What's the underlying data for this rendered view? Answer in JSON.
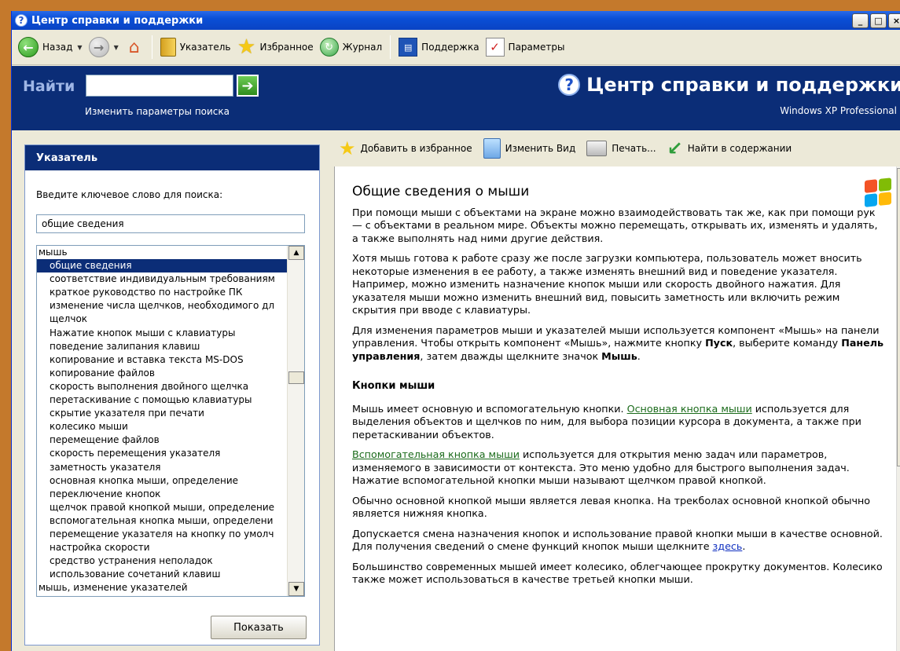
{
  "window": {
    "title": "Центр справки и поддержки",
    "controls": [
      "_",
      "□",
      "×"
    ]
  },
  "toolbar": {
    "back_label": "Назад",
    "index_label": "Указатель",
    "favorites_label": "Избранное",
    "history_label": "Журнал",
    "support_label": "Поддержка",
    "options_label": "Параметры"
  },
  "search": {
    "find_label": "Найти",
    "query": "",
    "go_symbol": "➔",
    "change_options_link": "Изменить параметры поиска"
  },
  "header": {
    "title": "Центр справки и поддержки",
    "edition": "Windows XP Professional"
  },
  "index_panel": {
    "title": "Указатель",
    "keyword_label": "Введите ключевое слово для поиска:",
    "keyword_value": "общие сведения",
    "items": [
      {
        "label": "мышь",
        "root": true,
        "selected": false
      },
      {
        "label": "общие сведения",
        "root": false,
        "selected": true
      },
      {
        "label": "соответствие индивидуальным требованиям",
        "root": false,
        "selected": false
      },
      {
        "label": "краткое руководство по настройке ПК",
        "root": false,
        "selected": false
      },
      {
        "label": "изменение числа щелчков, необходимого дл",
        "root": false,
        "selected": false
      },
      {
        "label": "щелчок",
        "root": false,
        "selected": false
      },
      {
        "label": "Нажатие кнопок мыши с клавиатуры",
        "root": false,
        "selected": false
      },
      {
        "label": "поведение залипания клавиш",
        "root": false,
        "selected": false
      },
      {
        "label": "копирование и вставка текста MS-DOS",
        "root": false,
        "selected": false
      },
      {
        "label": "копирование файлов",
        "root": false,
        "selected": false
      },
      {
        "label": "скорость выполнения двойного щелчка",
        "root": false,
        "selected": false
      },
      {
        "label": "перетаскивание с помощью клавиатуры",
        "root": false,
        "selected": false
      },
      {
        "label": "скрытие указателя при печати",
        "root": false,
        "selected": false
      },
      {
        "label": "колесико мыши",
        "root": false,
        "selected": false
      },
      {
        "label": "перемещение файлов",
        "root": false,
        "selected": false
      },
      {
        "label": "скорость перемещения указателя",
        "root": false,
        "selected": false
      },
      {
        "label": "заметность указателя",
        "root": false,
        "selected": false
      },
      {
        "label": "основная кнопка мыши, определение",
        "root": false,
        "selected": false
      },
      {
        "label": "переключение кнопок",
        "root": false,
        "selected": false
      },
      {
        "label": "щелчок правой кнопкой мыши, определение",
        "root": false,
        "selected": false
      },
      {
        "label": "вспомогательная кнопка мыши, определени",
        "root": false,
        "selected": false
      },
      {
        "label": "перемещение указателя на кнопку по умолч",
        "root": false,
        "selected": false
      },
      {
        "label": "настройка скорости",
        "root": false,
        "selected": false
      },
      {
        "label": "средство устранения неполадок",
        "root": false,
        "selected": false
      },
      {
        "label": "использование сочетаний клавиш",
        "root": false,
        "selected": false
      },
      {
        "label": "мышь, изменение указателей",
        "root": true,
        "selected": false
      }
    ],
    "show_button": "Показать"
  },
  "content_toolbar": {
    "add_favorites": "Добавить в избранное",
    "change_view": "Изменить Вид",
    "print": "Печать...",
    "find_in_contents": "Найти в содержании"
  },
  "article": {
    "title": "Общие сведения о мыши",
    "p1": "При помощи мыши с объектами на экране можно взаимодействовать так же, как при помощи рук — с объектами в реальном мире. Объекты можно перемещать, открывать их, изменять и удалять, а также выполнять над ними другие действия.",
    "p2": "Хотя мышь готова к работе сразу же после загрузки компьютера, пользователь может вносить некоторые изменения в ее работу, а также изменять внешний вид и поведение указателя. Например, можно изменить назначение кнопок мыши или скорость двойного нажатия. Для указателя мыши можно изменить внешний вид, повысить заметность или включить режим скрытия при вводе с клавиатуры.",
    "p3_a": "Для изменения параметров мыши и указателей мыши используется компонент «Мышь» на панели управления. Чтобы открыть компонент «Мышь», нажмите кнопку ",
    "p3_start": "Пуск",
    "p3_b": ", выберите команду ",
    "p3_cp": "Панель управления",
    "p3_c": ", затем дважды щелкните значок ",
    "p3_mouse": "Мышь",
    "p3_end": ".",
    "h2": "Кнопки мыши",
    "p4_a": "Мышь имеет основную и вспомогательную кнопки. ",
    "p4_link": "Основная кнопка мыши",
    "p4_b": " используется для выделения объектов и щелчков по ним, для выбора позиции курсора в документа, а также при перетаскивании объектов.",
    "p5_link": "Вспомогательная кнопка мыши",
    "p5_b": " используется для открытия меню задач или параметров, изменяемого в зависимости от контекста. Это меню удобно для быстрого выполнения задач. Нажатие вспомогательной кнопки мыши называют щелчком правой кнопкой.",
    "p6": "Обычно основной кнопкой мыши является левая кнопка. На трекболах основной кнопкой обычно является нижняя кнопка.",
    "p7_a": "Допускается смена назначения кнопок и использование правой кнопки мыши в качестве основной. Для получения сведений о смене функций кнопок мыши щелкните ",
    "p7_link": "здесь",
    "p7_end": ".",
    "p8": "Большинство современных мышей имеет колесико, облегчающее прокрутку документов. Колесико также может использоваться в качестве третьей кнопки мыши."
  },
  "colors": {
    "header_blue": "#0b2d77",
    "link_green": "#1b6b1b",
    "link_blue": "#1030c0",
    "selection": "#0b2d77"
  }
}
